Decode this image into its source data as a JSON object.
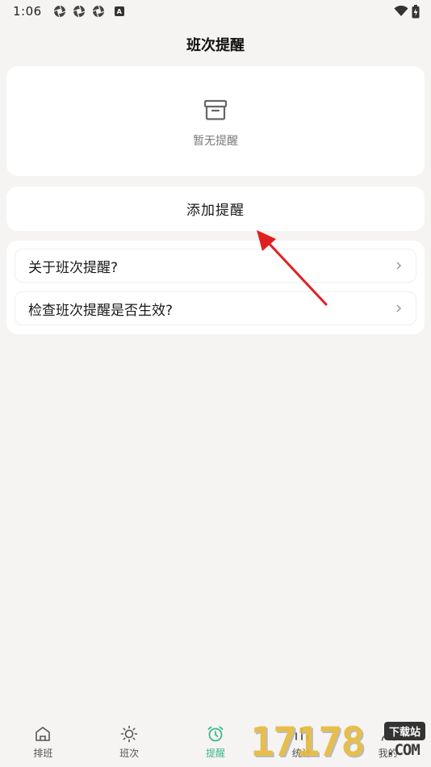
{
  "status_bar": {
    "time": "1:06",
    "badge": "A"
  },
  "header": {
    "title": "班次提醒"
  },
  "empty_state": {
    "icon": "archive-box-icon",
    "text": "暂无提醒"
  },
  "add_button": {
    "label": "添加提醒"
  },
  "faq": {
    "items": [
      {
        "label": "关于班次提醒?"
      },
      {
        "label": "检查班次提醒是否生效?"
      }
    ]
  },
  "bottom_nav": {
    "items": [
      {
        "label": "排班",
        "icon": "home-icon",
        "active": false
      },
      {
        "label": "班次",
        "icon": "sun-icon",
        "active": false
      },
      {
        "label": "提醒",
        "icon": "alarm-clock-icon",
        "active": true
      },
      {
        "label": "统计",
        "icon": "chart-icon",
        "active": false
      },
      {
        "label": "我的",
        "icon": "user-icon",
        "active": false
      }
    ]
  },
  "watermark": {
    "digits": "17178",
    "badge": "下载站",
    "suffix": ".COM"
  },
  "colors": {
    "background": "#f5f4f2",
    "card": "#ffffff",
    "accent": "#3fb88e",
    "arrow": "#e02020"
  }
}
